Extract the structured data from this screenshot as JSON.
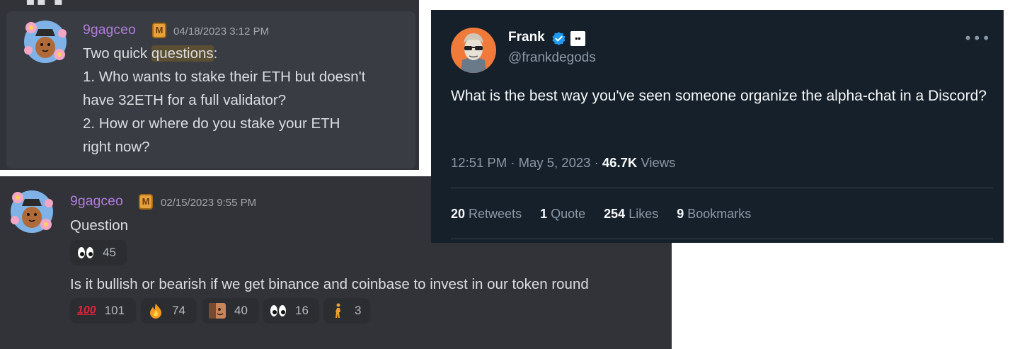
{
  "discord_top": {
    "username": "9gagceo",
    "badge_letter": "M",
    "timestamp": "04/18/2023 3:12 PM",
    "line1_pre": "Two quick ",
    "line1_highlight": "questions",
    "line1_post": ":",
    "line2": "1. Who wants to stake their ETH but doesn't",
    "line3": "have 32ETH for a full validator?",
    "line4": "2. How or where do you stake your ETH",
    "line5": "right now?",
    "name_color": "#b07ddb"
  },
  "discord_bottom": {
    "username": "9gagceo",
    "badge_letter": "M",
    "timestamp": "02/15/2023 9:55 PM",
    "message1": "Question",
    "message2": "Is it bullish or bearish if we get binance and coinbase to invest in our token round",
    "reaction_row1": [
      {
        "emoji": "eyes-emoji",
        "count": "45"
      }
    ],
    "reaction_row2": [
      {
        "emoji": "hundred-emoji",
        "glyph": "💯",
        "count": "101"
      },
      {
        "emoji": "fire-emoji",
        "glyph": "🔥",
        "count": "74"
      },
      {
        "emoji": "face-emoji",
        "count": "40"
      },
      {
        "emoji": "eyes-emoji",
        "count": "16"
      },
      {
        "emoji": "person-emoji",
        "count": "3"
      }
    ]
  },
  "tweet": {
    "name": "Frank",
    "handle": "@frankdegods",
    "text": "What is the best way you've seen someone organize the alpha-chat in a Discord?",
    "time": "12:51 PM · May 5, 2023 · ",
    "views_count": "46.7K",
    "views_label": " Views",
    "retweets_count": "20",
    "retweets_label": " Retweets",
    "quotes_count": "1",
    "quotes_label": " Quote",
    "likes_count": "254",
    "likes_label": " Likes",
    "bookmarks_count": "9",
    "bookmarks_label": " Bookmarks",
    "verified_color": "#1d9bf0",
    "more_icon": "more-icon"
  }
}
